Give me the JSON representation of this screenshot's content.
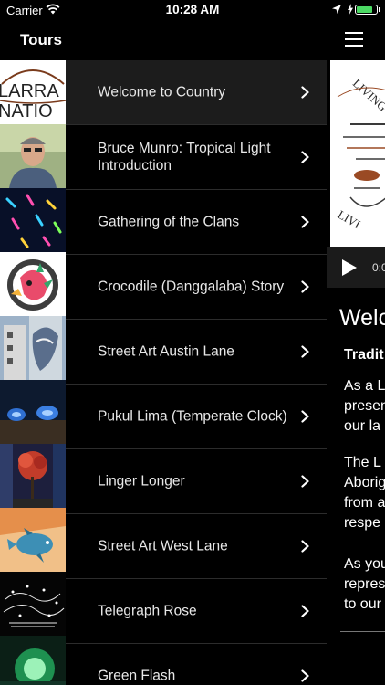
{
  "status_bar": {
    "carrier": "Carrier",
    "time": "10:28 AM",
    "battery_level": 0.9,
    "battery_color": "#4cd964"
  },
  "nav": {
    "title": "Tours",
    "menu_icon": "hamburger-menu-icon"
  },
  "tours": [
    {
      "label": "Welcome to Country",
      "selected": true
    },
    {
      "label": "Bruce Munro: Tropical Light Introduction",
      "selected": false
    },
    {
      "label": "Gathering of the Clans",
      "selected": false
    },
    {
      "label": "Crocodile (Danggalaba) Story",
      "selected": false
    },
    {
      "label": "Street Art Austin Lane",
      "selected": false
    },
    {
      "label": "Pukul Lima (Temperate Clock)",
      "selected": false
    },
    {
      "label": "Linger Longer",
      "selected": false
    },
    {
      "label": "Street Art West Lane",
      "selected": false
    },
    {
      "label": "Telegraph Rose",
      "selected": false
    },
    {
      "label": "Green Flash",
      "selected": false
    }
  ],
  "thumbnails": {
    "logo_text": "LARRA\nNATIO"
  },
  "content": {
    "image_text_top": "LIVING",
    "image_text_bottom": "LIVI",
    "player_time": "0:0",
    "title": "Welco",
    "subtitle": "Tradit",
    "paragraphs": [
      "As a L\npresen\nour la",
      "The L\nAborig\nfrom a\nrespe",
      "As you\nrepres\nto our"
    ]
  }
}
